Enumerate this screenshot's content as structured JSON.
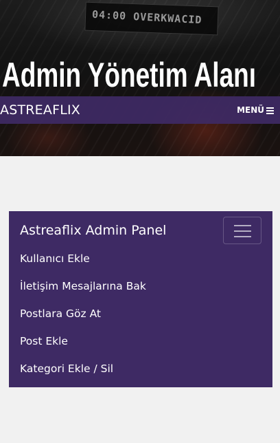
{
  "hero": {
    "sign_text": "04:00 OVERKWACID",
    "title": "Admin Yönetim Alanı"
  },
  "navbar": {
    "brand": "ASTREAFLIX",
    "menu_label": "MENÜ",
    "menu_icon": "bars-icon"
  },
  "panel": {
    "title": "Astreaflix Admin Panel",
    "toggler_icon": "hamburger-icon",
    "items": [
      {
        "label": "Kullanıcı Ekle"
      },
      {
        "label": "İletişim Mesajlarına Bak"
      },
      {
        "label": "Postlara Göz At"
      },
      {
        "label": "Post Ekle"
      },
      {
        "label": "Kategori Ekle / Sil"
      }
    ]
  },
  "colors": {
    "accent": "#3e2a64",
    "page_background": "#f1f1f1",
    "text_on_accent": "#ffffff"
  }
}
